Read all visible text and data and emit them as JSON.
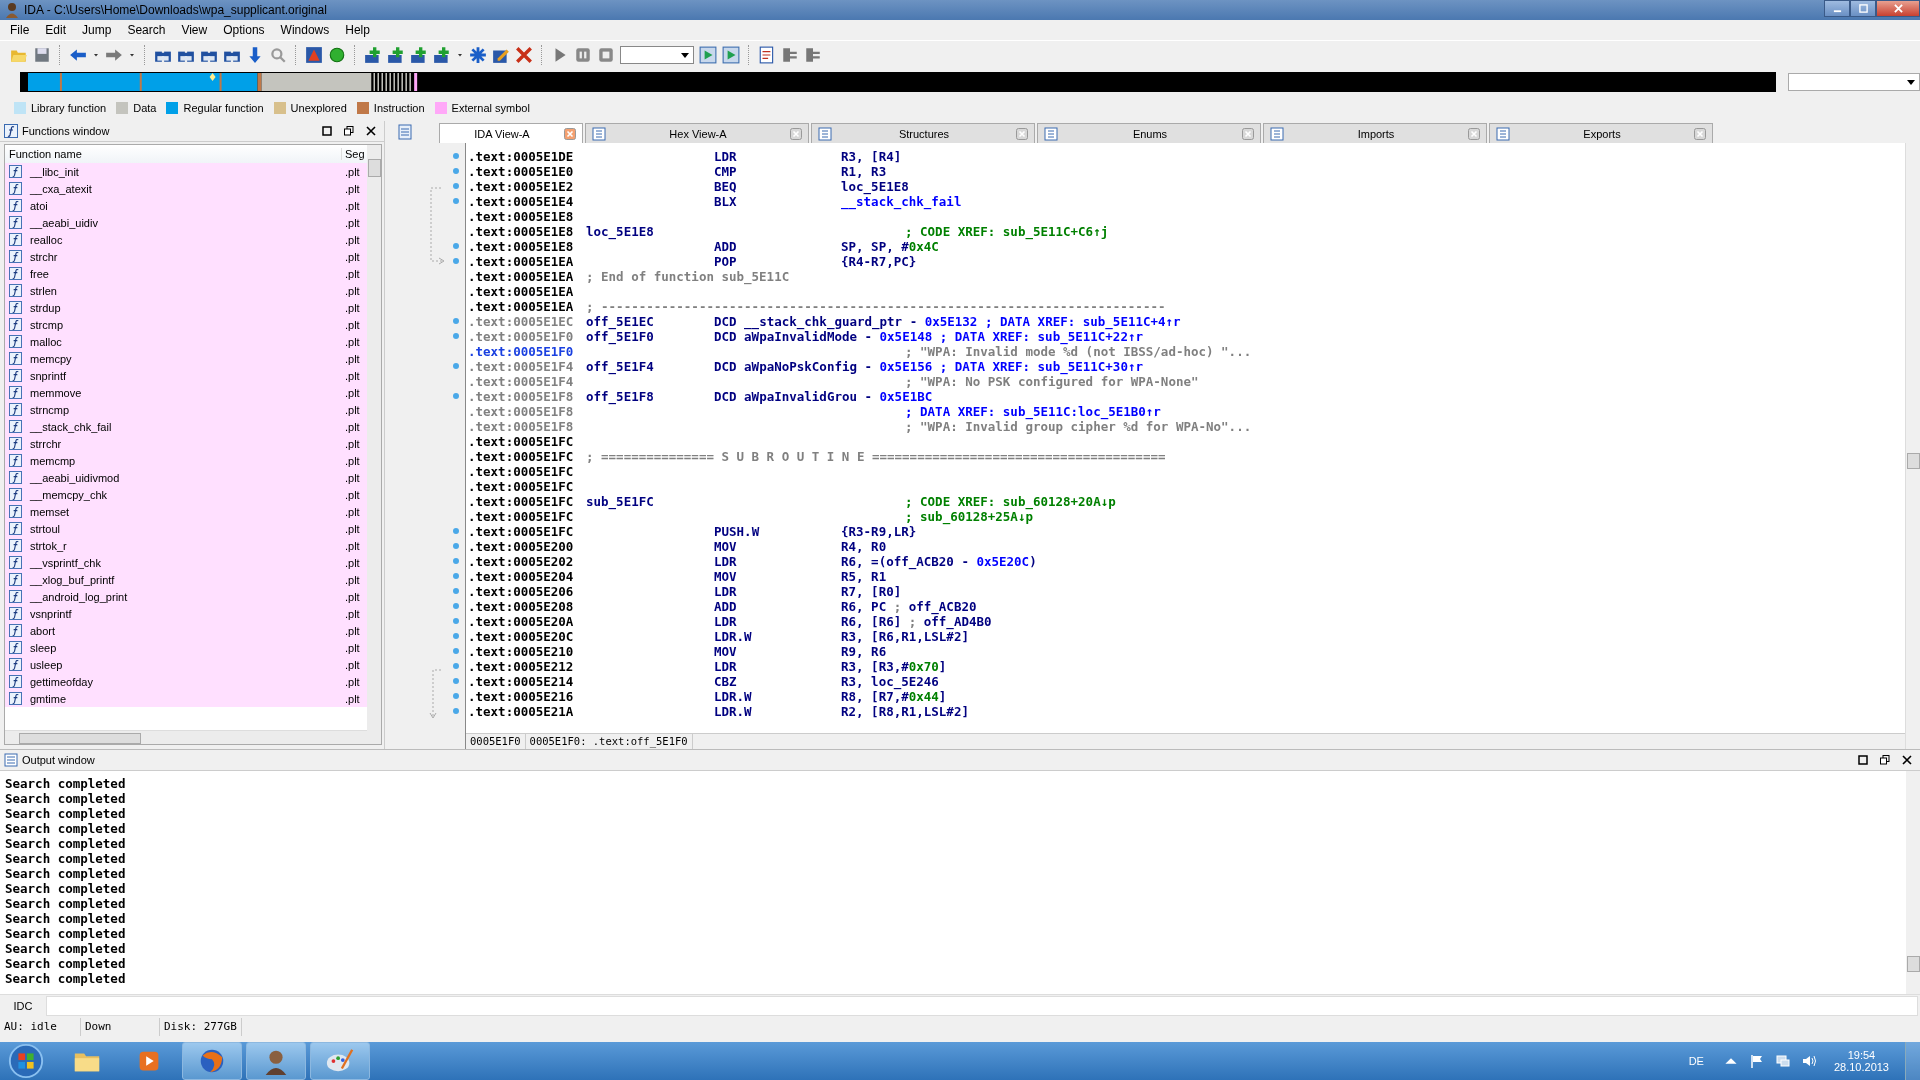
{
  "window": {
    "title": "IDA - C:\\Users\\Home\\Downloads\\wpa_supplicant.original"
  },
  "menu": [
    "File",
    "Edit",
    "Jump",
    "Search",
    "View",
    "Options",
    "Windows",
    "Help"
  ],
  "legend": [
    {
      "label": "Library function",
      "color": "#bfe4f6"
    },
    {
      "label": "Data",
      "color": "#c4c4be"
    },
    {
      "label": "Regular function",
      "color": "#00a0e8"
    },
    {
      "label": "Unexplored",
      "color": "#d8c08c"
    },
    {
      "label": "Instruction",
      "color": "#c07848"
    },
    {
      "label": "External symbol",
      "color": "#ffa8f8"
    }
  ],
  "functions_window": {
    "title": "Functions window",
    "columns": [
      "Function name",
      "Seg"
    ],
    "rows": [
      {
        "name": "__libc_init",
        "segment": ".plt"
      },
      {
        "name": "__cxa_atexit",
        "segment": ".plt"
      },
      {
        "name": "atoi",
        "segment": ".plt"
      },
      {
        "name": "__aeabi_uidiv",
        "segment": ".plt"
      },
      {
        "name": "realloc",
        "segment": ".plt"
      },
      {
        "name": "strchr",
        "segment": ".plt"
      },
      {
        "name": "free",
        "segment": ".plt"
      },
      {
        "name": "strlen",
        "segment": ".plt"
      },
      {
        "name": "strdup",
        "segment": ".plt"
      },
      {
        "name": "strcmp",
        "segment": ".plt"
      },
      {
        "name": "malloc",
        "segment": ".plt"
      },
      {
        "name": "memcpy",
        "segment": ".plt"
      },
      {
        "name": "snprintf",
        "segment": ".plt"
      },
      {
        "name": "memmove",
        "segment": ".plt"
      },
      {
        "name": "strncmp",
        "segment": ".plt"
      },
      {
        "name": "__stack_chk_fail",
        "segment": ".plt"
      },
      {
        "name": "strrchr",
        "segment": ".plt"
      },
      {
        "name": "memcmp",
        "segment": ".plt"
      },
      {
        "name": "__aeabi_uidivmod",
        "segment": ".plt"
      },
      {
        "name": "__memcpy_chk",
        "segment": ".plt"
      },
      {
        "name": "memset",
        "segment": ".plt"
      },
      {
        "name": "strtoul",
        "segment": ".plt"
      },
      {
        "name": "strtok_r",
        "segment": ".plt"
      },
      {
        "name": "__vsprintf_chk",
        "segment": ".plt"
      },
      {
        "name": "__xlog_buf_printf",
        "segment": ".plt"
      },
      {
        "name": "__android_log_print",
        "segment": ".plt"
      },
      {
        "name": "vsnprintf",
        "segment": ".plt"
      },
      {
        "name": "abort",
        "segment": ".plt"
      },
      {
        "name": "sleep",
        "segment": ".plt"
      },
      {
        "name": "usleep",
        "segment": ".plt"
      },
      {
        "name": "gettimeofday",
        "segment": ".plt"
      },
      {
        "name": "gmtime",
        "segment": ".plt"
      }
    ]
  },
  "tabs": [
    {
      "label": "IDA View-A",
      "selected": true
    },
    {
      "label": "Hex View-A",
      "selected": false
    },
    {
      "label": "Structures",
      "selected": false
    },
    {
      "label": "Enums",
      "selected": false
    },
    {
      "label": "Imports",
      "selected": false
    },
    {
      "label": "Exports",
      "selected": false
    }
  ],
  "listing": [
    {
      "addr": ".text:0005E1DE",
      "dimmed": false,
      "selected": false,
      "dot": true,
      "kind": "insn",
      "mnem": "LDR",
      "ops": [
        {
          "t": "R3, [R4]",
          "kind": "reg"
        }
      ]
    },
    {
      "addr": ".text:0005E1E0",
      "dimmed": false,
      "selected": false,
      "dot": true,
      "kind": "insn",
      "mnem": "CMP",
      "ops": [
        {
          "t": "R1, R3",
          "kind": "reg"
        }
      ]
    },
    {
      "addr": ".text:0005E1E2",
      "dimmed": false,
      "selected": false,
      "dot": true,
      "kind": "insn",
      "mnem": "BEQ",
      "ops": [
        {
          "t": "loc_5E1E8",
          "kind": "reg"
        }
      ]
    },
    {
      "addr": ".text:0005E1E4",
      "dimmed": false,
      "selected": false,
      "dot": true,
      "kind": "insn",
      "mnem": "BLX",
      "ops": [
        {
          "t": "__stack_chk_fail",
          "kind": "name"
        }
      ]
    },
    {
      "addr": ".text:0005E1E8",
      "dimmed": false,
      "selected": false,
      "dot": false,
      "kind": "blank"
    },
    {
      "addr": ".text:0005E1E8",
      "dimmed": false,
      "selected": false,
      "dot": false,
      "kind": "blank",
      "label": "loc_5E1E8",
      "comment": {
        "t": "; CODE XREF: sub_5E11C+C6↑j",
        "kind": "xref_code"
      }
    },
    {
      "addr": ".text:0005E1E8",
      "dimmed": false,
      "selected": false,
      "dot": true,
      "kind": "insn",
      "mnem": "ADD",
      "ops": [
        {
          "t": "SP, SP, #",
          "kind": "reg"
        },
        {
          "t": "0x4C",
          "kind": "num"
        }
      ]
    },
    {
      "addr": ".text:0005E1EA",
      "dimmed": false,
      "selected": false,
      "dot": true,
      "kind": "insn",
      "mnem": "POP",
      "ops": [
        {
          "t": "{R4-R7,PC}",
          "kind": "reg"
        }
      ]
    },
    {
      "addr": ".text:0005E1EA",
      "dimmed": false,
      "selected": false,
      "dot": false,
      "kind": "blank",
      "comment": {
        "t": "; End of function sub_5E11C",
        "kind": "note"
      }
    },
    {
      "addr": ".text:0005E1EA",
      "dimmed": false,
      "selected": false,
      "dot": false,
      "kind": "blank"
    },
    {
      "addr": ".text:0005E1EA",
      "dimmed": false,
      "selected": false,
      "dot": false,
      "kind": "blank",
      "comment": {
        "t": "; ---------------------------------------------------------------------------",
        "kind": "note"
      }
    },
    {
      "addr": ".text:0005E1EC",
      "dimmed": true,
      "selected": false,
      "dot": true,
      "kind": "data",
      "label": "off_5E1EC",
      "mnem": "DCD",
      "ops": [
        {
          "t": "__stack_chk_guard_ptr - ",
          "kind": "reg"
        },
        {
          "t": "0x5E132",
          "kind": "name"
        }
      ],
      "comment": {
        "t": "; DATA XREF: sub_5E11C+4↑r",
        "kind": "xref_data"
      }
    },
    {
      "addr": ".text:0005E1F0",
      "dimmed": true,
      "selected": false,
      "dot": true,
      "kind": "data",
      "label": "off_5E1F0",
      "mnem": "DCD",
      "ops": [
        {
          "t": "aWpaInvalidMode - ",
          "kind": "reg"
        },
        {
          "t": "0x5E148",
          "kind": "name"
        }
      ],
      "comment": {
        "t": "; DATA XREF: sub_5E11C+22↑r",
        "kind": "xref_data"
      }
    },
    {
      "addr": ".text:0005E1F0",
      "selected": true,
      "dot": false,
      "kind": "blank",
      "comment": {
        "t": "; \"WPA: Invalid mode %d (not IBSS/ad-hoc) \"...",
        "kind": "string"
      }
    },
    {
      "addr": ".text:0005E1F4",
      "dimmed": true,
      "selected": false,
      "dot": true,
      "kind": "data",
      "label": "off_5E1F4",
      "mnem": "DCD",
      "ops": [
        {
          "t": "aWpaNoPskConfig - ",
          "kind": "reg"
        },
        {
          "t": "0x5E156",
          "kind": "name"
        }
      ],
      "comment": {
        "t": "; DATA XREF: sub_5E11C+30↑r",
        "kind": "xref_data"
      }
    },
    {
      "addr": ".text:0005E1F4",
      "dimmed": true,
      "selected": false,
      "dot": false,
      "kind": "blank",
      "comment": {
        "t": "; \"WPA: No PSK configured for WPA-None\"",
        "kind": "string"
      }
    },
    {
      "addr": ".text:0005E1F8",
      "dimmed": true,
      "selected": false,
      "dot": true,
      "kind": "data",
      "label": "off_5E1F8",
      "mnem": "DCD",
      "ops": [
        {
          "t": "aWpaInvalidGrou - ",
          "kind": "reg"
        },
        {
          "t": "0x5E1BC",
          "kind": "name"
        }
      ]
    },
    {
      "addr": ".text:0005E1F8",
      "dimmed": true,
      "selected": false,
      "dot": false,
      "kind": "blank",
      "comment": {
        "t": "; DATA XREF: sub_5E11C:loc_5E1B0↑r",
        "kind": "xref_data"
      }
    },
    {
      "addr": ".text:0005E1F8",
      "dimmed": true,
      "selected": false,
      "dot": false,
      "kind": "blank",
      "comment": {
        "t": "; \"WPA: Invalid group cipher %d for WPA-No\"...",
        "kind": "string"
      }
    },
    {
      "addr": ".text:0005E1FC",
      "dimmed": false,
      "selected": false,
      "dot": false,
      "kind": "blank"
    },
    {
      "addr": ".text:0005E1FC",
      "dimmed": false,
      "selected": false,
      "dot": false,
      "kind": "blank",
      "comment": {
        "t": "; =============== S U B R O U T I N E =======================================",
        "kind": "note"
      }
    },
    {
      "addr": ".text:0005E1FC",
      "dimmed": false,
      "selected": false,
      "dot": false,
      "kind": "blank"
    },
    {
      "addr": ".text:0005E1FC",
      "dimmed": false,
      "selected": false,
      "dot": false,
      "kind": "blank"
    },
    {
      "addr": ".text:0005E1FC",
      "dimmed": false,
      "selected": false,
      "dot": false,
      "kind": "blank",
      "label": "sub_5E1FC",
      "comment": {
        "t": "; CODE XREF: sub_60128+20A↓p",
        "kind": "xref_code"
      }
    },
    {
      "addr": ".text:0005E1FC",
      "dimmed": false,
      "selected": false,
      "dot": false,
      "kind": "blank",
      "comment": {
        "t": "; sub_60128+25A↓p",
        "kind": "xref_code"
      }
    },
    {
      "addr": ".text:0005E1FC",
      "dimmed": false,
      "selected": false,
      "dot": true,
      "kind": "insn",
      "mnem": "PUSH.W",
      "ops": [
        {
          "t": "{R3-R9,LR}",
          "kind": "reg"
        }
      ]
    },
    {
      "addr": ".text:0005E200",
      "dimmed": false,
      "selected": false,
      "dot": true,
      "kind": "insn",
      "mnem": "MOV",
      "ops": [
        {
          "t": "R4, R0",
          "kind": "reg"
        }
      ]
    },
    {
      "addr": ".text:0005E202",
      "dimmed": false,
      "selected": false,
      "dot": true,
      "kind": "insn",
      "mnem": "LDR",
      "ops": [
        {
          "t": "R6, =(off_ACB20 - ",
          "kind": "reg"
        },
        {
          "t": "0x5E20C",
          "kind": "name"
        },
        {
          "t": ")",
          "kind": "reg"
        }
      ]
    },
    {
      "addr": ".text:0005E204",
      "dimmed": false,
      "selected": false,
      "dot": true,
      "kind": "insn",
      "mnem": "MOV",
      "ops": [
        {
          "t": "R5, R1",
          "kind": "reg"
        }
      ]
    },
    {
      "addr": ".text:0005E206",
      "dimmed": false,
      "selected": false,
      "dot": true,
      "kind": "insn",
      "mnem": "LDR",
      "ops": [
        {
          "t": "R7, [R0]",
          "kind": "reg"
        }
      ]
    },
    {
      "addr": ".text:0005E208",
      "dimmed": false,
      "selected": false,
      "dot": true,
      "kind": "insn",
      "mnem": "ADD",
      "ops": [
        {
          "t": "R6, PC ",
          "kind": "reg"
        },
        {
          "t": ";",
          "kind": "cmt"
        },
        {
          "t": " off_ACB20",
          "kind": "reg"
        }
      ]
    },
    {
      "addr": ".text:0005E20A",
      "dimmed": false,
      "selected": false,
      "dot": true,
      "kind": "insn",
      "mnem": "LDR",
      "ops": [
        {
          "t": "R6, [R6] ",
          "kind": "reg"
        },
        {
          "t": ";",
          "kind": "cmt"
        },
        {
          "t": " off_AD4B0",
          "kind": "reg"
        }
      ]
    },
    {
      "addr": ".text:0005E20C",
      "dimmed": false,
      "selected": false,
      "dot": true,
      "kind": "insn",
      "mnem": "LDR.W",
      "ops": [
        {
          "t": "R3, [R6,R1,LSL#2]",
          "kind": "reg"
        }
      ]
    },
    {
      "addr": ".text:0005E210",
      "dimmed": false,
      "selected": false,
      "dot": true,
      "kind": "insn",
      "mnem": "MOV",
      "ops": [
        {
          "t": "R9, R6",
          "kind": "reg"
        }
      ]
    },
    {
      "addr": ".text:0005E212",
      "dimmed": false,
      "selected": false,
      "dot": true,
      "kind": "insn",
      "mnem": "LDR",
      "ops": [
        {
          "t": "R3, [R3,#",
          "kind": "reg"
        },
        {
          "t": "0x70",
          "kind": "num"
        },
        {
          "t": "]",
          "kind": "reg"
        }
      ]
    },
    {
      "addr": ".text:0005E214",
      "dimmed": false,
      "selected": false,
      "dot": true,
      "kind": "insn",
      "mnem": "CBZ",
      "ops": [
        {
          "t": "R3, loc_5E246",
          "kind": "reg"
        }
      ]
    },
    {
      "addr": ".text:0005E216",
      "dimmed": false,
      "selected": false,
      "dot": true,
      "kind": "insn",
      "mnem": "LDR.W",
      "ops": [
        {
          "t": "R8, [R7,#",
          "kind": "reg"
        },
        {
          "t": "0x44",
          "kind": "num"
        },
        {
          "t": "]",
          "kind": "reg"
        }
      ]
    },
    {
      "addr": ".text:0005E21A",
      "dimmed": false,
      "selected": false,
      "dot": true,
      "kind": "insn",
      "mnem": "LDR.W",
      "ops": [
        {
          "t": "R2, [R8,R1,LSL#2]",
          "kind": "reg"
        }
      ]
    }
  ],
  "listing_status": [
    "0005E1F0",
    "0005E1F0: .text:off_5E1F0"
  ],
  "output_window": {
    "title": "Output window",
    "lines": [
      "Search completed",
      "Search completed",
      "Search completed",
      "Search completed",
      "Search completed",
      "Search completed",
      "Search completed",
      "Search completed",
      "Search completed",
      "Search completed",
      "Search completed",
      "Search completed",
      "Search completed",
      "Search completed"
    ]
  },
  "command_line": {
    "label": "IDC"
  },
  "status_bar": [
    "AU:  idle",
    "Down",
    "Disk: 277GB"
  ],
  "taskbar": {
    "language": "DE",
    "time": "19:54",
    "date": "28.10.2013"
  }
}
